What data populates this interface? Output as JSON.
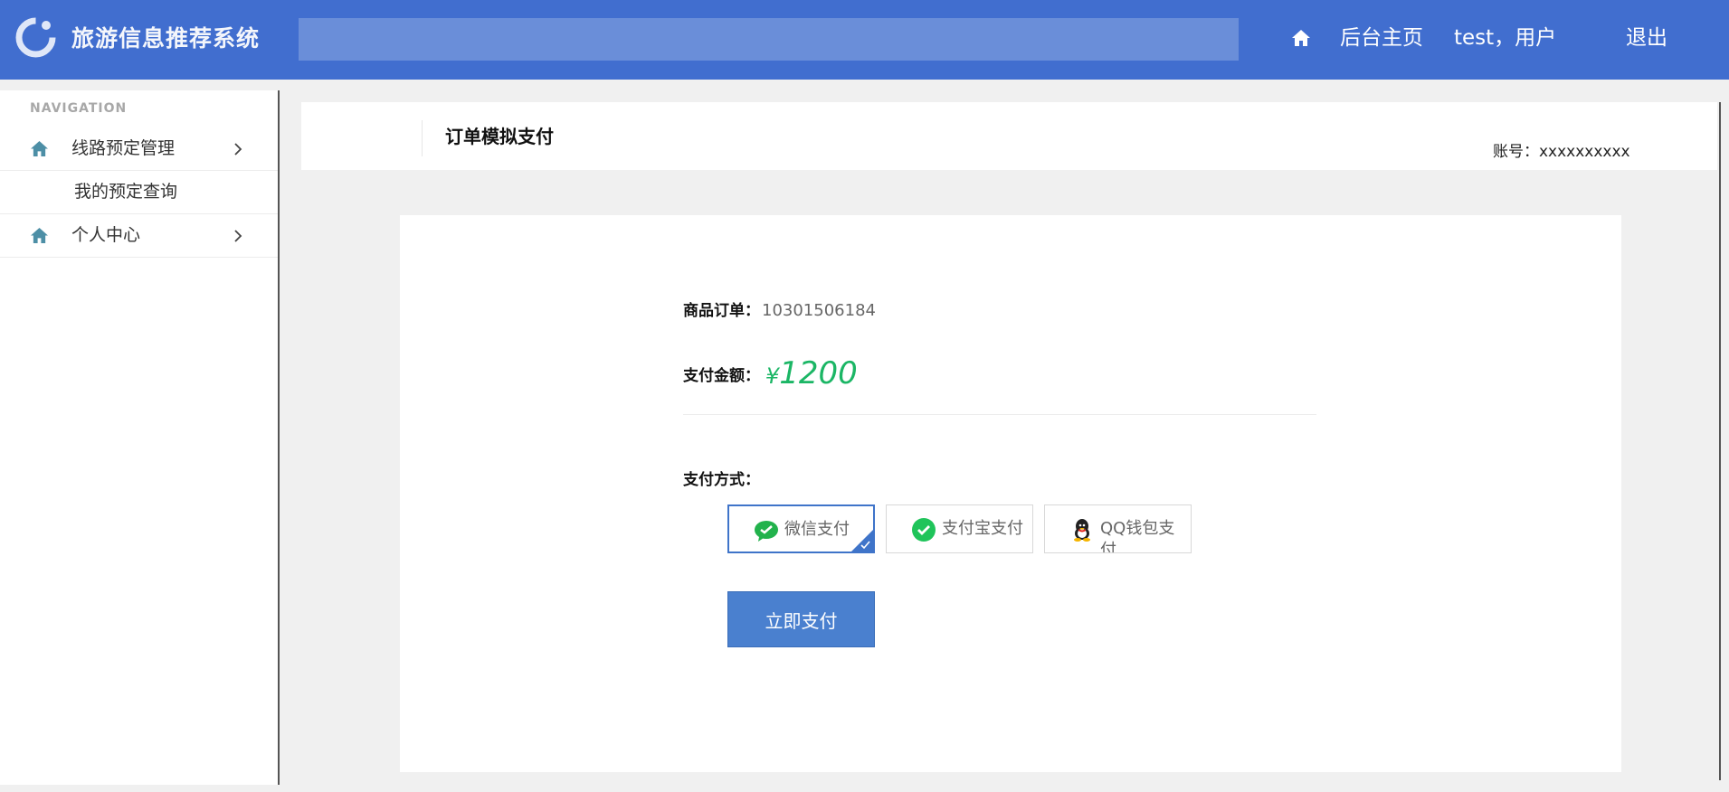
{
  "header": {
    "app_title": "旅游信息推荐系统",
    "search_value": "",
    "admin_home": "后台主页",
    "user_greeting": "test，用户",
    "logout": "退出",
    "brand_color": "#416ecf"
  },
  "sidebar": {
    "heading": "NAVIGATION",
    "items": [
      {
        "label": "线路预定管理",
        "icon": "home-icon"
      },
      {
        "label": "我的预定查询"
      },
      {
        "label": "个人中心",
        "icon": "home-icon"
      }
    ]
  },
  "main": {
    "page_title": "订单模拟支付",
    "account": "账号：xxxxxxxxxx",
    "order_label": "商品订单：",
    "order_number": "10301506184",
    "amount_label": "支付金额：",
    "currency": "¥",
    "amount": "1200",
    "amount_color": "#1bb665",
    "method_label": "支付方式：",
    "payment_options": [
      {
        "label": "微信支付",
        "icon": "wechat-icon",
        "selected": true
      },
      {
        "label": "支付宝支付",
        "icon": "alipay-icon",
        "selected": false
      },
      {
        "label": "QQ钱包支付",
        "icon": "qq-icon",
        "selected": false
      }
    ],
    "pay_button": "立即支付"
  }
}
